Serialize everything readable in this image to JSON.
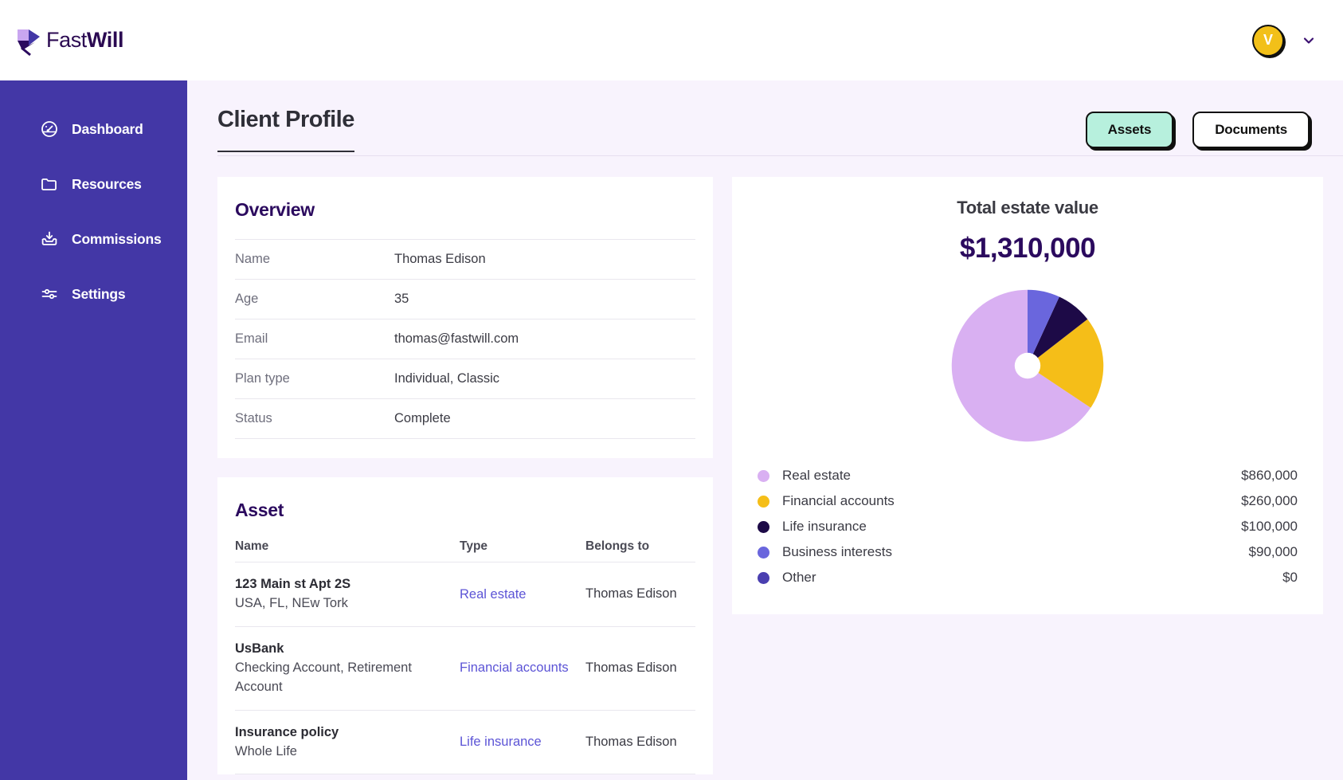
{
  "brand": {
    "light": "Fast",
    "bold": "Will",
    "mark": "quill-feather-icon"
  },
  "topbar": {
    "avatar_initial": "V",
    "chevron": "chevron-down-icon"
  },
  "sidebar": {
    "items": [
      {
        "label": "Dashboard",
        "icon": "speedometer-icon"
      },
      {
        "label": "Resources",
        "icon": "folder-icon"
      },
      {
        "label": "Commissions",
        "icon": "inbox-download-icon"
      },
      {
        "label": "Settings",
        "icon": "sliders-icon"
      }
    ]
  },
  "page": {
    "title": "Client Profile",
    "buttons": {
      "assets": "Assets",
      "documents": "Documents"
    }
  },
  "overview": {
    "title": "Overview",
    "rows": [
      {
        "key": "Name",
        "value": "Thomas Edison"
      },
      {
        "key": "Age",
        "value": "35"
      },
      {
        "key": "Email",
        "value": "thomas@fastwill.com"
      },
      {
        "key": "Plan type",
        "value": "Individual, Classic"
      },
      {
        "key": "Status",
        "value": "Complete"
      }
    ]
  },
  "asset": {
    "title": "Asset",
    "columns": [
      "Name",
      "Type",
      "Belongs to"
    ],
    "rows": [
      {
        "name": "123 Main st Apt 2S",
        "sub": "USA, FL, NEw Tork",
        "type": "Real estate",
        "owner": "Thomas Edison"
      },
      {
        "name": "UsBank",
        "sub": "Checking Account, Retirement Account",
        "type": "Financial accounts",
        "owner": "Thomas Edison"
      },
      {
        "name": "Insurance policy",
        "sub": "Whole Life",
        "type": "Life insurance",
        "owner": "Thomas Edison"
      }
    ]
  },
  "chart_data": {
    "type": "pie",
    "title": "Total estate value",
    "total_label": "$1,310,000",
    "total_value": 1310000,
    "currency": "USD",
    "donut": true,
    "inner_radius_ratio": 0.17,
    "start_angle_deg": 90,
    "direction": "counterclockwise",
    "legend_position": "bottom",
    "categories": [
      "Real estate",
      "Financial accounts",
      "Life insurance",
      "Business interests",
      "Other"
    ],
    "values": [
      860000,
      260000,
      100000,
      90000,
      0
    ],
    "value_labels": [
      "$860,000",
      "$260,000",
      "$100,000",
      "$90,000",
      "$0"
    ],
    "percentages": [
      65.6,
      19.8,
      7.6,
      6.9,
      0.0
    ],
    "colors": [
      "#d9b0f2",
      "#f5be18",
      "#1d0a47",
      "#6a66dd",
      "#4a3fb0"
    ]
  }
}
